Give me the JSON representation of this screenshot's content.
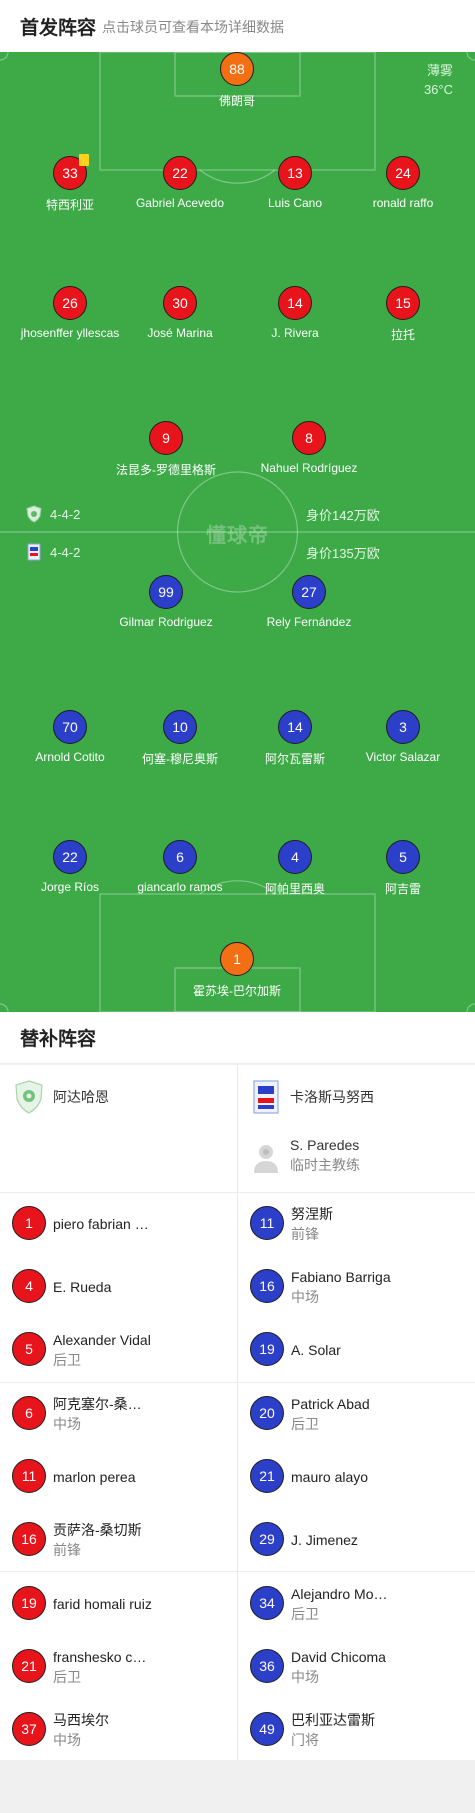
{
  "header": {
    "title": "首发阵容",
    "subtitle": "点击球员可查看本场详细数据"
  },
  "weather": {
    "condition": "薄雾",
    "temperature": "36°C"
  },
  "watermark": "懂球帝",
  "home": {
    "formation": "4-4-2",
    "value": "身价142万欧",
    "color": "#e8141b",
    "gk": {
      "number": "88",
      "name": "佛朗哥"
    },
    "def": [
      {
        "number": "33",
        "name": "特西利亚",
        "yellow_card": true
      },
      {
        "number": "22",
        "name": "Gabriel Acevedo"
      },
      {
        "number": "13",
        "name": "Luis Cano"
      },
      {
        "number": "24",
        "name": "ronald raffo"
      }
    ],
    "mid": [
      {
        "number": "26",
        "name": "jhosenffer yllescas"
      },
      {
        "number": "30",
        "name": "José Marina"
      },
      {
        "number": "14",
        "name": "J. Rivera"
      },
      {
        "number": "15",
        "name": "拉托"
      }
    ],
    "fwd": [
      {
        "number": "9",
        "name": "法昆多-罗德里格斯"
      },
      {
        "number": "8",
        "name": "Nahuel Rodríguez"
      }
    ]
  },
  "away": {
    "formation": "4-4-2",
    "value": "身价135万欧",
    "color": "#2b3fc8",
    "fwd": [
      {
        "number": "99",
        "name": "Gilmar Rodriguez"
      },
      {
        "number": "27",
        "name": "Rely Fernández"
      }
    ],
    "mid": [
      {
        "number": "70",
        "name": "Arnold Cotito"
      },
      {
        "number": "10",
        "name": "何塞-穆尼奥斯"
      },
      {
        "number": "14",
        "name": "阿尔瓦雷斯"
      },
      {
        "number": "3",
        "name": "Victor Salazar"
      }
    ],
    "def": [
      {
        "number": "22",
        "name": "Jorge Ríos"
      },
      {
        "number": "6",
        "name": "giancarlo ramos"
      },
      {
        "number": "4",
        "name": "阿帕里西奥"
      },
      {
        "number": "5",
        "name": "阿吉雷"
      }
    ],
    "gk": {
      "number": "1",
      "name": "霍苏埃-巴尔加斯"
    }
  },
  "subs": {
    "title": "替补阵容",
    "home_team": "阿达哈恩",
    "away_team": "卡洛斯马努西",
    "away_coach": {
      "name": "S. Paredes",
      "role": "临时主教练"
    },
    "home": [
      {
        "number": "1",
        "name": "piero fabrian …",
        "position": ""
      },
      {
        "number": "4",
        "name": "E. Rueda",
        "position": ""
      },
      {
        "number": "5",
        "name": "Alexander Vidal",
        "position": "后卫"
      },
      {
        "number": "6",
        "name": "阿克塞尔-桑…",
        "position": "中场"
      },
      {
        "number": "11",
        "name": "marlon perea",
        "position": ""
      },
      {
        "number": "16",
        "name": "贡萨洛-桑切斯",
        "position": "前锋"
      },
      {
        "number": "19",
        "name": "farid homali ruiz",
        "position": ""
      },
      {
        "number": "21",
        "name": "franshesko c…",
        "position": "后卫"
      },
      {
        "number": "37",
        "name": "马西埃尔",
        "position": "中场"
      }
    ],
    "away": [
      {
        "number": "11",
        "name": "努涅斯",
        "position": "前锋"
      },
      {
        "number": "16",
        "name": "Fabiano Barriga",
        "position": "中场"
      },
      {
        "number": "19",
        "name": "A. Solar",
        "position": ""
      },
      {
        "number": "20",
        "name": "Patrick Abad",
        "position": "后卫"
      },
      {
        "number": "21",
        "name": "mauro alayo",
        "position": ""
      },
      {
        "number": "29",
        "name": "J. Jimenez",
        "position": ""
      },
      {
        "number": "34",
        "name": "Alejandro Mo…",
        "position": "后卫"
      },
      {
        "number": "36",
        "name": "David Chicoma",
        "position": "中场"
      },
      {
        "number": "49",
        "name": "巴利亚达雷斯",
        "position": "门将"
      }
    ]
  }
}
